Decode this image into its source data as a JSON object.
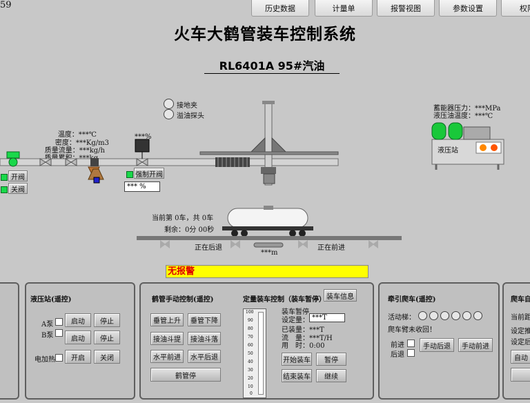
{
  "corner_text": "59",
  "nav": [
    "历史数据",
    "计量单",
    "报警视图",
    "参数设置",
    "权限"
  ],
  "title": "火车大鹤管装车控制系统",
  "subtitle": "RL6401A 95#汽油",
  "indicators": {
    "grounding": "接地夹",
    "overflow": "溢油探头"
  },
  "metrics": {
    "temp": "温度：***℃",
    "density": "密度：***Kg/m3",
    "mass_flow": "质量流量：***kg/h",
    "mass_total": "质量累积：***kg"
  },
  "valve_percent": "***%",
  "force_open": "强制开阀",
  "valve_value": "*** %",
  "open_valve": "开阀",
  "close_valve": "关阀",
  "hydraulic_station": {
    "accumulator": "蓄能器压力：***MPa",
    "oil_temp": "液压油温度：***℃",
    "label": "液压站"
  },
  "car_info": {
    "count": "当前第 0车，共 0车",
    "remaining": "剩余：0分 00秒"
  },
  "track": {
    "back": "正在后退",
    "forward": "正在前进",
    "distance": "***m"
  },
  "alarm": "无报警",
  "panel_hydraulic": {
    "title": "液压站(遥控)",
    "pumpA": "A泵",
    "pumpB": "B泵",
    "heater": "电加热",
    "start": "启动",
    "stop": "停止",
    "on": "开启",
    "off": "关闭"
  },
  "panel_crane": {
    "title": "鹤管手动控制(遥控)",
    "buttons": [
      "垂管上升",
      "垂管下降",
      "接油斗提",
      "接油斗落",
      "水平前进",
      "水平后退"
    ],
    "stop": "鹤管停"
  },
  "panel_quant": {
    "title": "定量装车控制（装车暂停）",
    "info_btn": "装车信息",
    "status": "装车暂停",
    "setpoint_label": "设定量：",
    "setpoint_value": "***T",
    "loaded": "已装量：***T",
    "flow": "流　量：***T/H",
    "time": "用　时：0:00",
    "scale": [
      "100",
      "90",
      "80",
      "70",
      "60",
      "50",
      "40",
      "30",
      "20",
      "10",
      "0"
    ],
    "buttons": [
      "开始装车",
      "暂停",
      "结束装车",
      "继续"
    ]
  },
  "panel_tractor": {
    "title": "牵引爬车(遥控)",
    "ladder": "活动梯：",
    "notice": "爬车臂未收回！",
    "forward": "前进",
    "back": "后退",
    "manual_back": "手动后退",
    "manual_forward": "手动前进"
  },
  "panel_right": {
    "title": "爬车自",
    "line1": "当前距",
    "line2": "设定推",
    "line3": "设定后",
    "button": "自动"
  },
  "colors": {
    "led_green": "#19d84a",
    "alarm_bg": "#ffff00",
    "alarm_text": "#e00000"
  }
}
